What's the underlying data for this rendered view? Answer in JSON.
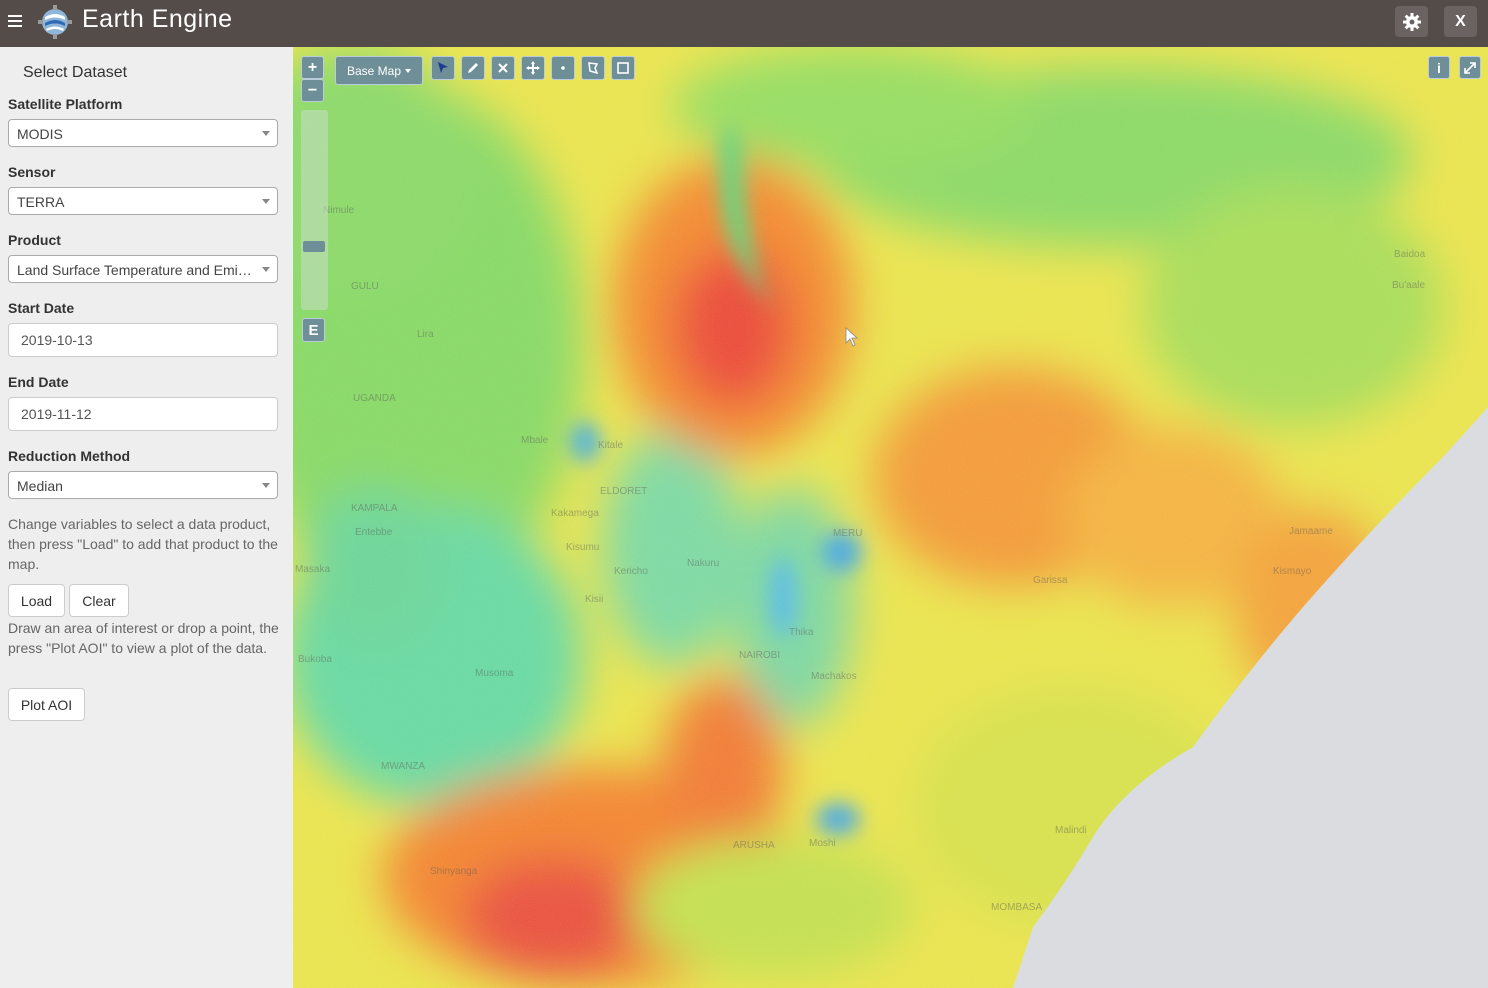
{
  "header": {
    "title": "Earth Engine",
    "close_label": "X"
  },
  "sidebar": {
    "panel_title": "Select Dataset",
    "platform": {
      "label": "Satellite Platform",
      "value": "MODIS"
    },
    "sensor": {
      "label": "Sensor",
      "value": "TERRA"
    },
    "product": {
      "label": "Product",
      "value": "Land Surface Temperature and Emissivity"
    },
    "start_date": {
      "label": "Start Date",
      "value": "2019-10-13"
    },
    "end_date": {
      "label": "End Date",
      "value": "2019-11-12"
    },
    "reduction": {
      "label": "Reduction Method",
      "value": "Median"
    },
    "help_load": "Change variables to select a data product, then press \"Load\" to add that product to the map.",
    "load_label": "Load",
    "clear_label": "Clear",
    "help_aoi": "Draw an area of interest or drop a point, the press \"Plot AOI\" to view a plot of the data.",
    "plot_label": "Plot AOI"
  },
  "map": {
    "zoom_in": "+",
    "zoom_out": "−",
    "basemap_label": "Base Map",
    "e_label": "E",
    "info_label": "i",
    "places": [
      "Nimule",
      "GULU",
      "Lira",
      "UGANDA",
      "Mbale",
      "Kitale",
      "ELDORET",
      "KAMPALA",
      "Entebbe",
      "Kakamega",
      "Masaka",
      "Kisumu",
      "Kericho",
      "Nakuru",
      "Kisii",
      "MERU",
      "Thika",
      "NAIROBI",
      "Bukoba",
      "Musoma",
      "Machakos",
      "MWANZA",
      "Shinyanga",
      "ARUSHA",
      "Moshi",
      "MOMBASA",
      "Malindi",
      "Garissa",
      "Jamaame",
      "Kismayo",
      "Baidoa",
      "Bu'aale"
    ]
  }
}
